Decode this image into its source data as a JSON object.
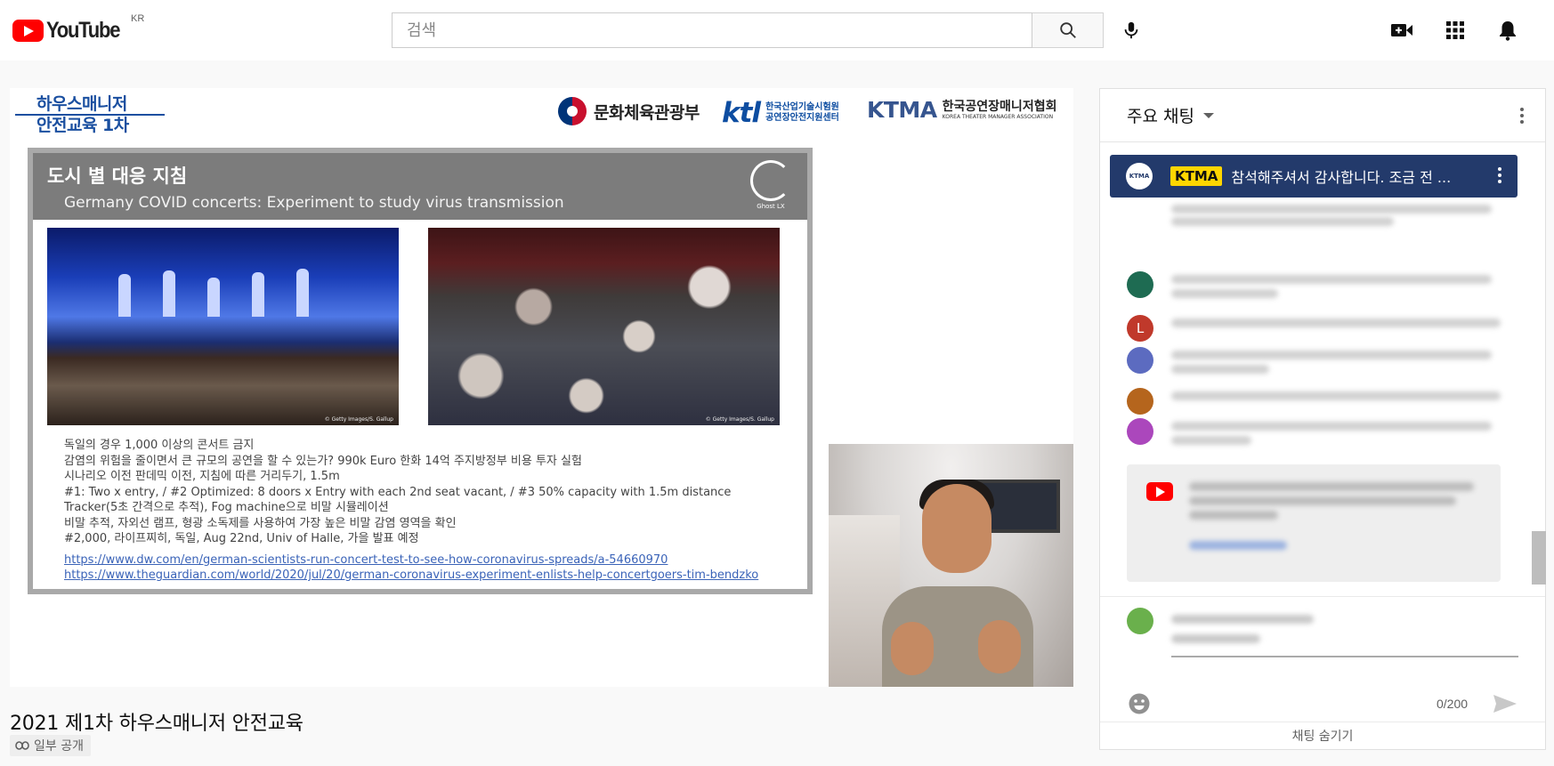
{
  "header": {
    "logo_text": "YouTube",
    "region": "KR",
    "search_placeholder": "검색",
    "icons": [
      "search-icon",
      "mic-icon",
      "create-video-icon",
      "apps-grid-icon",
      "notifications-bell-icon"
    ]
  },
  "video": {
    "header_logo_line1": "하우스매니저",
    "header_logo_line2": "안전교육 1차",
    "sponsor1": "문화체육관광부",
    "sponsor2_big": "ktl",
    "sponsor2_small1": "한국산업기술시험원",
    "sponsor2_small2": "공연장안전지원센터",
    "sponsor3_big": "KTMA",
    "sponsor3_kr": "한국공연장매니저협회",
    "sponsor3_en": "KOREA THEATER MANAGER ASSOCIATION",
    "slide": {
      "title": "도시 별 대응 지침",
      "subtitle": "Germany COVID concerts: Experiment to study virus transmission",
      "badge": "Ghost LX",
      "credit1": "© Getty Images/S. Gallup",
      "credit2": "© Getty Images/S. Gallup",
      "lines": [
        "독일의 경우 1,000 이상의 콘서트 금지",
        "감염의 위험을 줄이면서 큰 규모의 공연을 할 수 있는가? 990k Euro 한화 14억 주지방정부 비용 투자 실험",
        "시나리오 이전 판데믹 이전,  지침에 따른 거리두기, 1.5m",
        "#1: Two x entry, / #2 Optimized: 8 doors x Entry with each 2nd seat vacant, / #3 50% capacity with 1.5m distance",
        "Tracker(5초 간격으로 추적), Fog machine으로 비말 시뮬레이션",
        "비말 추적, 자외선 램프, 형광 소독제를 사용하여 가장 높은 비말 감염 영역을 확인",
        "#2,000, 라이프찌히, 독일, Aug 22nd, Univ of Halle, 가을 발표 예정"
      ],
      "links": [
        "https://www.dw.com/en/german-scientists-run-concert-test-to-see-how-coronavirus-spreads/a-54660970",
        "https://www.theguardian.com/world/2020/jul/20/german-coronavirus-experiment-enlists-help-concertgoers-tim-bendzko"
      ]
    }
  },
  "title": "2021 제1차 하우스매니저 안전교육",
  "privacy": "일부 공개",
  "chat": {
    "header": "주요 채팅",
    "pinned": {
      "avatar_text": "KTMA",
      "author_badge": "KTMA",
      "message": "참석해주셔서 감사합니다. 조금 전 ..."
    },
    "char_count": "0/200",
    "hide_label": "채팅 숨기기",
    "avatar_colors": [
      "#1e6b52",
      "#c0392b",
      "#5c6bc0",
      "#b5651d",
      "#ab47bc",
      "#6ab04c"
    ],
    "avatar_letter": "L"
  }
}
